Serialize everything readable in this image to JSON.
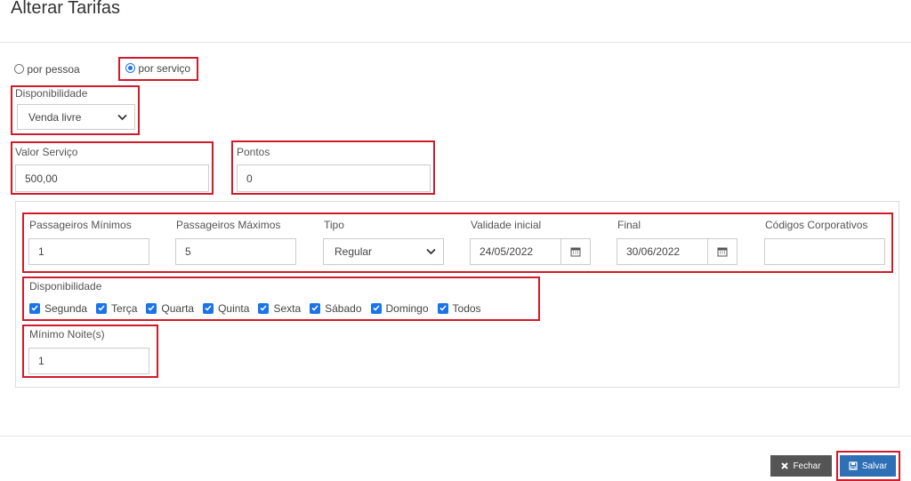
{
  "title": "Alterar Tarifas",
  "mode": {
    "options": [
      "por pessoa",
      "por serviço"
    ],
    "selected": "por serviço"
  },
  "disponibilidade_top": {
    "label": "Disponibilidade",
    "value": "Venda livre"
  },
  "valor_servico": {
    "label": "Valor Serviço",
    "value": "500,00"
  },
  "pontos": {
    "label": "Pontos",
    "value": "0"
  },
  "row": {
    "pax_min": {
      "label": "Passageiros Mínimos",
      "value": "1"
    },
    "pax_max": {
      "label": "Passageiros Máximos",
      "value": "5"
    },
    "tipo": {
      "label": "Tipo",
      "value": "Regular"
    },
    "validade_inicial": {
      "label": "Validade inicial",
      "value": "24/05/2022"
    },
    "final": {
      "label": "Final",
      "value": "30/06/2022"
    },
    "codigos": {
      "label": "Códigos Corporativos",
      "value": ""
    }
  },
  "dias": {
    "label": "Disponibilidade",
    "items": [
      {
        "label": "Segunda",
        "checked": true
      },
      {
        "label": "Terça",
        "checked": true
      },
      {
        "label": "Quarta",
        "checked": true
      },
      {
        "label": "Quinta",
        "checked": true
      },
      {
        "label": "Sexta",
        "checked": true
      },
      {
        "label": "Sábado",
        "checked": true
      },
      {
        "label": "Domingo",
        "checked": true
      },
      {
        "label": "Todos",
        "checked": true
      }
    ]
  },
  "minimo_noites": {
    "label": "Mínimo Noite(s)",
    "value": "1"
  },
  "buttons": {
    "fechar": "Fechar",
    "salvar": "Salvar"
  },
  "colors": {
    "primary": "#1a73e8",
    "highlight": "#d11a2a",
    "close_btn": "#555555",
    "save_btn": "#2f6fb5"
  }
}
